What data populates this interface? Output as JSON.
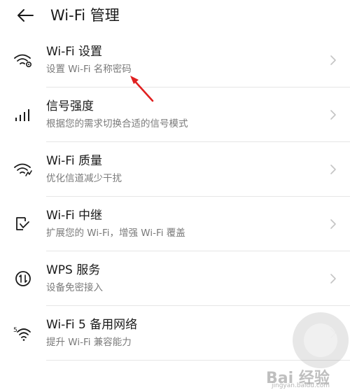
{
  "header": {
    "title": "Wi-Fi 管理"
  },
  "items": [
    {
      "title": "Wi-Fi 设置",
      "subtitle": "设置 Wi-Fi 名称密码",
      "icon": "wifi-settings-icon"
    },
    {
      "title": "信号强度",
      "subtitle": "根据您的需求切换合适的信号模式",
      "icon": "signal-strength-icon"
    },
    {
      "title": "Wi-Fi 质量",
      "subtitle": "优化信道减少干扰",
      "icon": "wifi-quality-icon"
    },
    {
      "title": "Wi-Fi 中继",
      "subtitle": "扩展您的 Wi-Fi，增强 Wi-Fi 覆盖",
      "icon": "wifi-relay-icon"
    },
    {
      "title": "WPS 服务",
      "subtitle": "设备免密接入",
      "icon": "wps-icon"
    },
    {
      "title": "Wi-Fi 5 备用网络",
      "subtitle": "提升 Wi-Fi 兼容能力",
      "icon": "wifi5-icon"
    }
  ],
  "watermark": {
    "text": "Bai 经验",
    "sub": "jingyan.baidu.com"
  },
  "colors": {
    "text": "#1a1a1a",
    "subtext": "#7a7a7a",
    "divider": "#e6e6e6",
    "annotation": "#e02020",
    "chevron": "#c4c4c4"
  }
}
